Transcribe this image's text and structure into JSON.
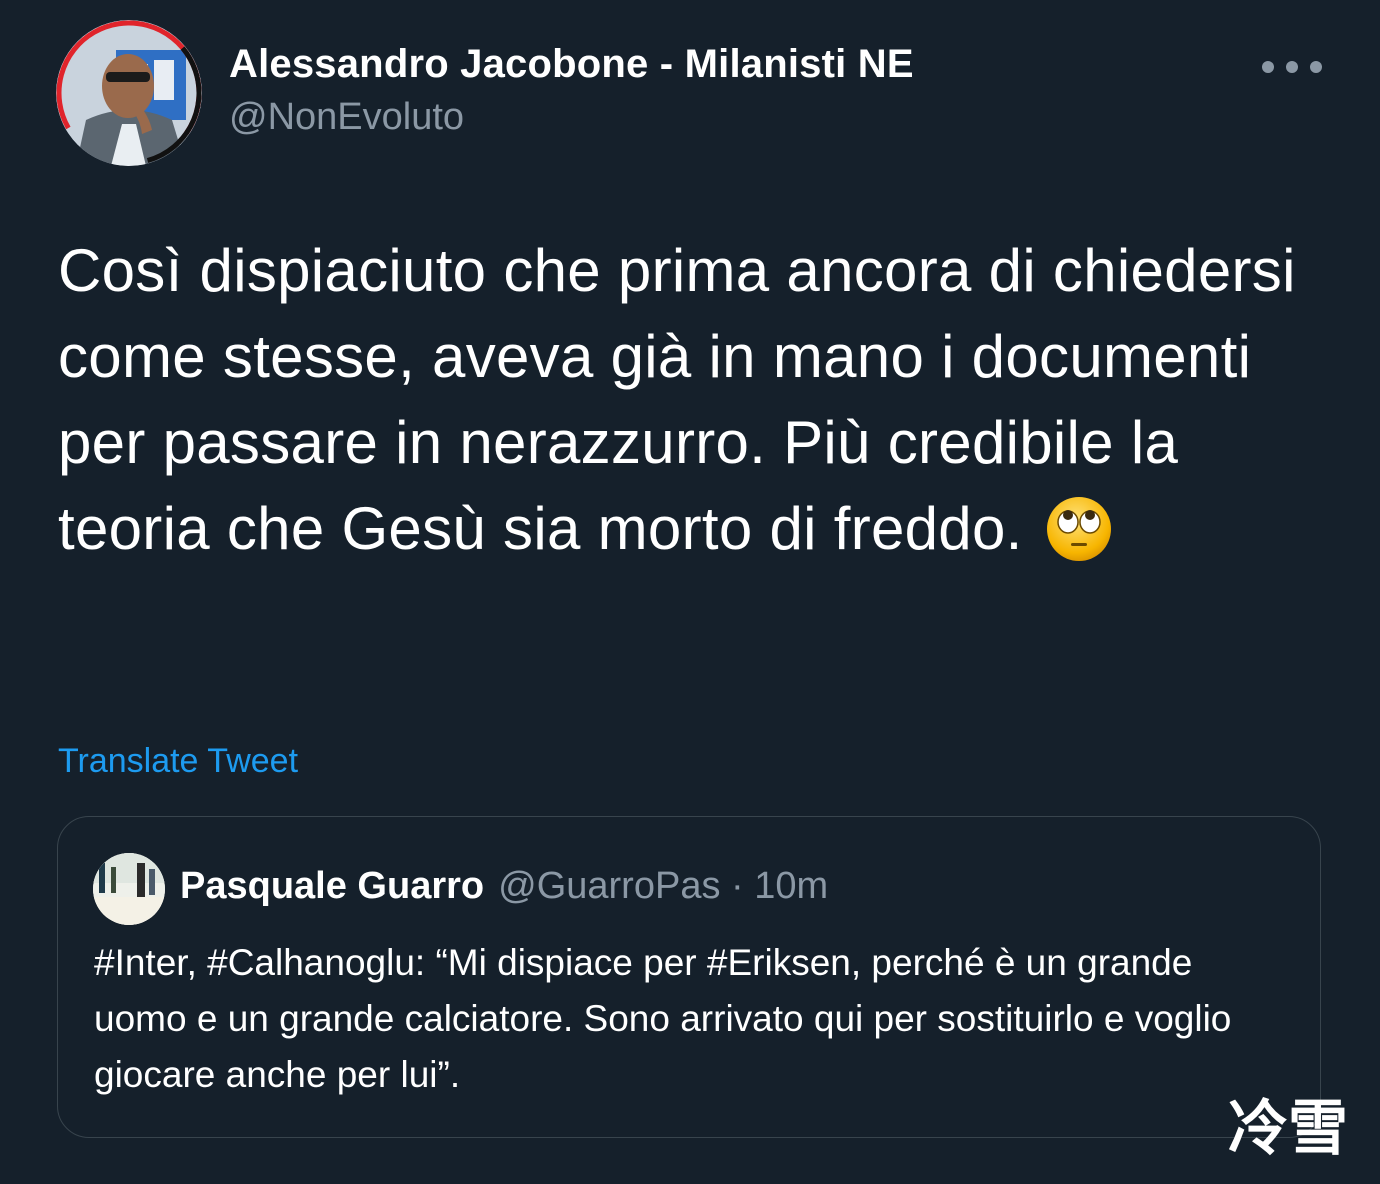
{
  "author": {
    "name": "Alessandro Jacobone - Milanisti NE",
    "handle": "@NonEvoluto"
  },
  "tweet": {
    "text": "Così dispiaciuto che prima ancora di chiedersi come stesse, aveva già in mano i documenti per passare in nerazzurro. Più credibile la teoria che Gesù sia morto di freddo.",
    "emoji": "face-with-rolling-eyes"
  },
  "actions": {
    "translate_label": "Translate Tweet",
    "more_icon": "more-horizontal-icon"
  },
  "quoted": {
    "name": "Pasquale Guarro",
    "handle": "@GuarroPas",
    "separator": " · ",
    "time": "10m",
    "text": "#Inter, #Calhanoglu: “Mi dispiace per #Eriksen, perché è un grande uomo e un grande calciatore. Sono arrivato qui per sostituirlo e voglio giocare anche per lui”."
  },
  "watermark": "冷雪",
  "colors": {
    "background": "#15202b",
    "text": "#ffffff",
    "secondary": "#8b98a5",
    "link": "#1d9bf0",
    "border": "#38444d",
    "avatar_ring": "#e0242b"
  }
}
